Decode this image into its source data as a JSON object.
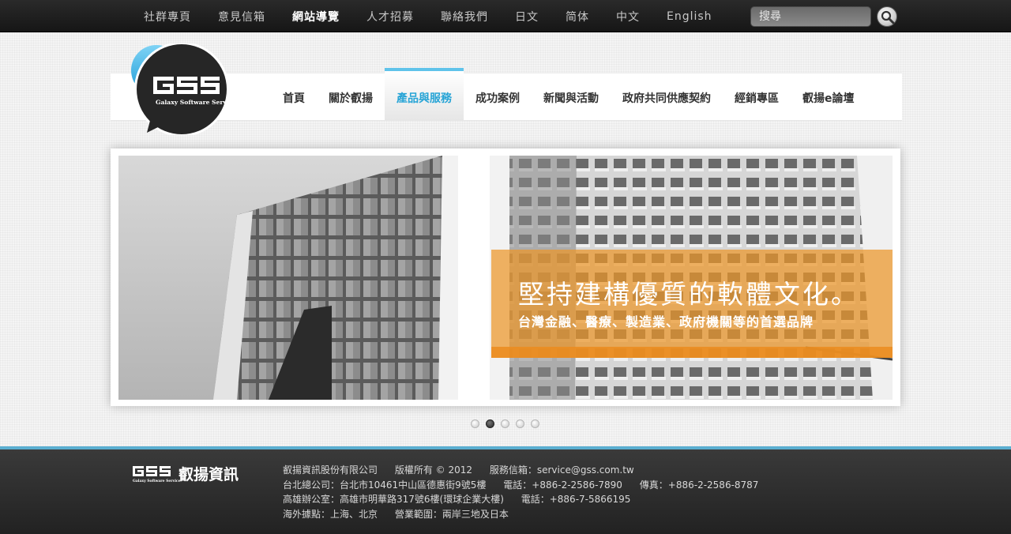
{
  "topbar": {
    "links": [
      "社群專頁",
      "意見信箱",
      "網站導覽",
      "人才招募",
      "聯絡我們",
      "日文",
      "简体",
      "中文",
      "English"
    ],
    "active_index": 2,
    "search_placeholder": "搜尋"
  },
  "nav": {
    "items": [
      "首頁",
      "關於叡揚",
      "產品與服務",
      "成功案例",
      "新聞與活動",
      "政府共同供應契約",
      "經銷專區",
      "叡揚e論壇"
    ],
    "active_index": 2
  },
  "logo": {
    "brand": "GSS",
    "tagline": "Galaxy Software Service"
  },
  "slider": {
    "headline": "堅持建構優質的軟體文化。",
    "subline": "台灣金融、醫療、製造業、政府機關等的首選品牌",
    "slide_count": 5,
    "active_slide": 1
  },
  "footer": {
    "logo_text": "叡揚資訊",
    "line1": [
      "叡揚資訊股份有限公司",
      "版權所有 © 2012",
      "服務信箱：service@gss.com.tw"
    ],
    "line2": [
      "台北總公司：台北市10461中山區德惠街9號5樓",
      "電話：+886-2-2586-7890",
      "傳真：+886-2-2586-8787"
    ],
    "line3": [
      "高雄辦公室：高雄市明華路317號6樓(環球企業大樓)",
      "電話：+886-7-5866195"
    ],
    "line4": [
      "海外據點：上海、北京",
      "營業範圍：兩岸三地及日本"
    ]
  },
  "colors": {
    "accent": "#27a4d6",
    "caption_orange": "#ec9628",
    "topbar": "#1e1e1e",
    "footer_rule": "#5aaed0"
  }
}
